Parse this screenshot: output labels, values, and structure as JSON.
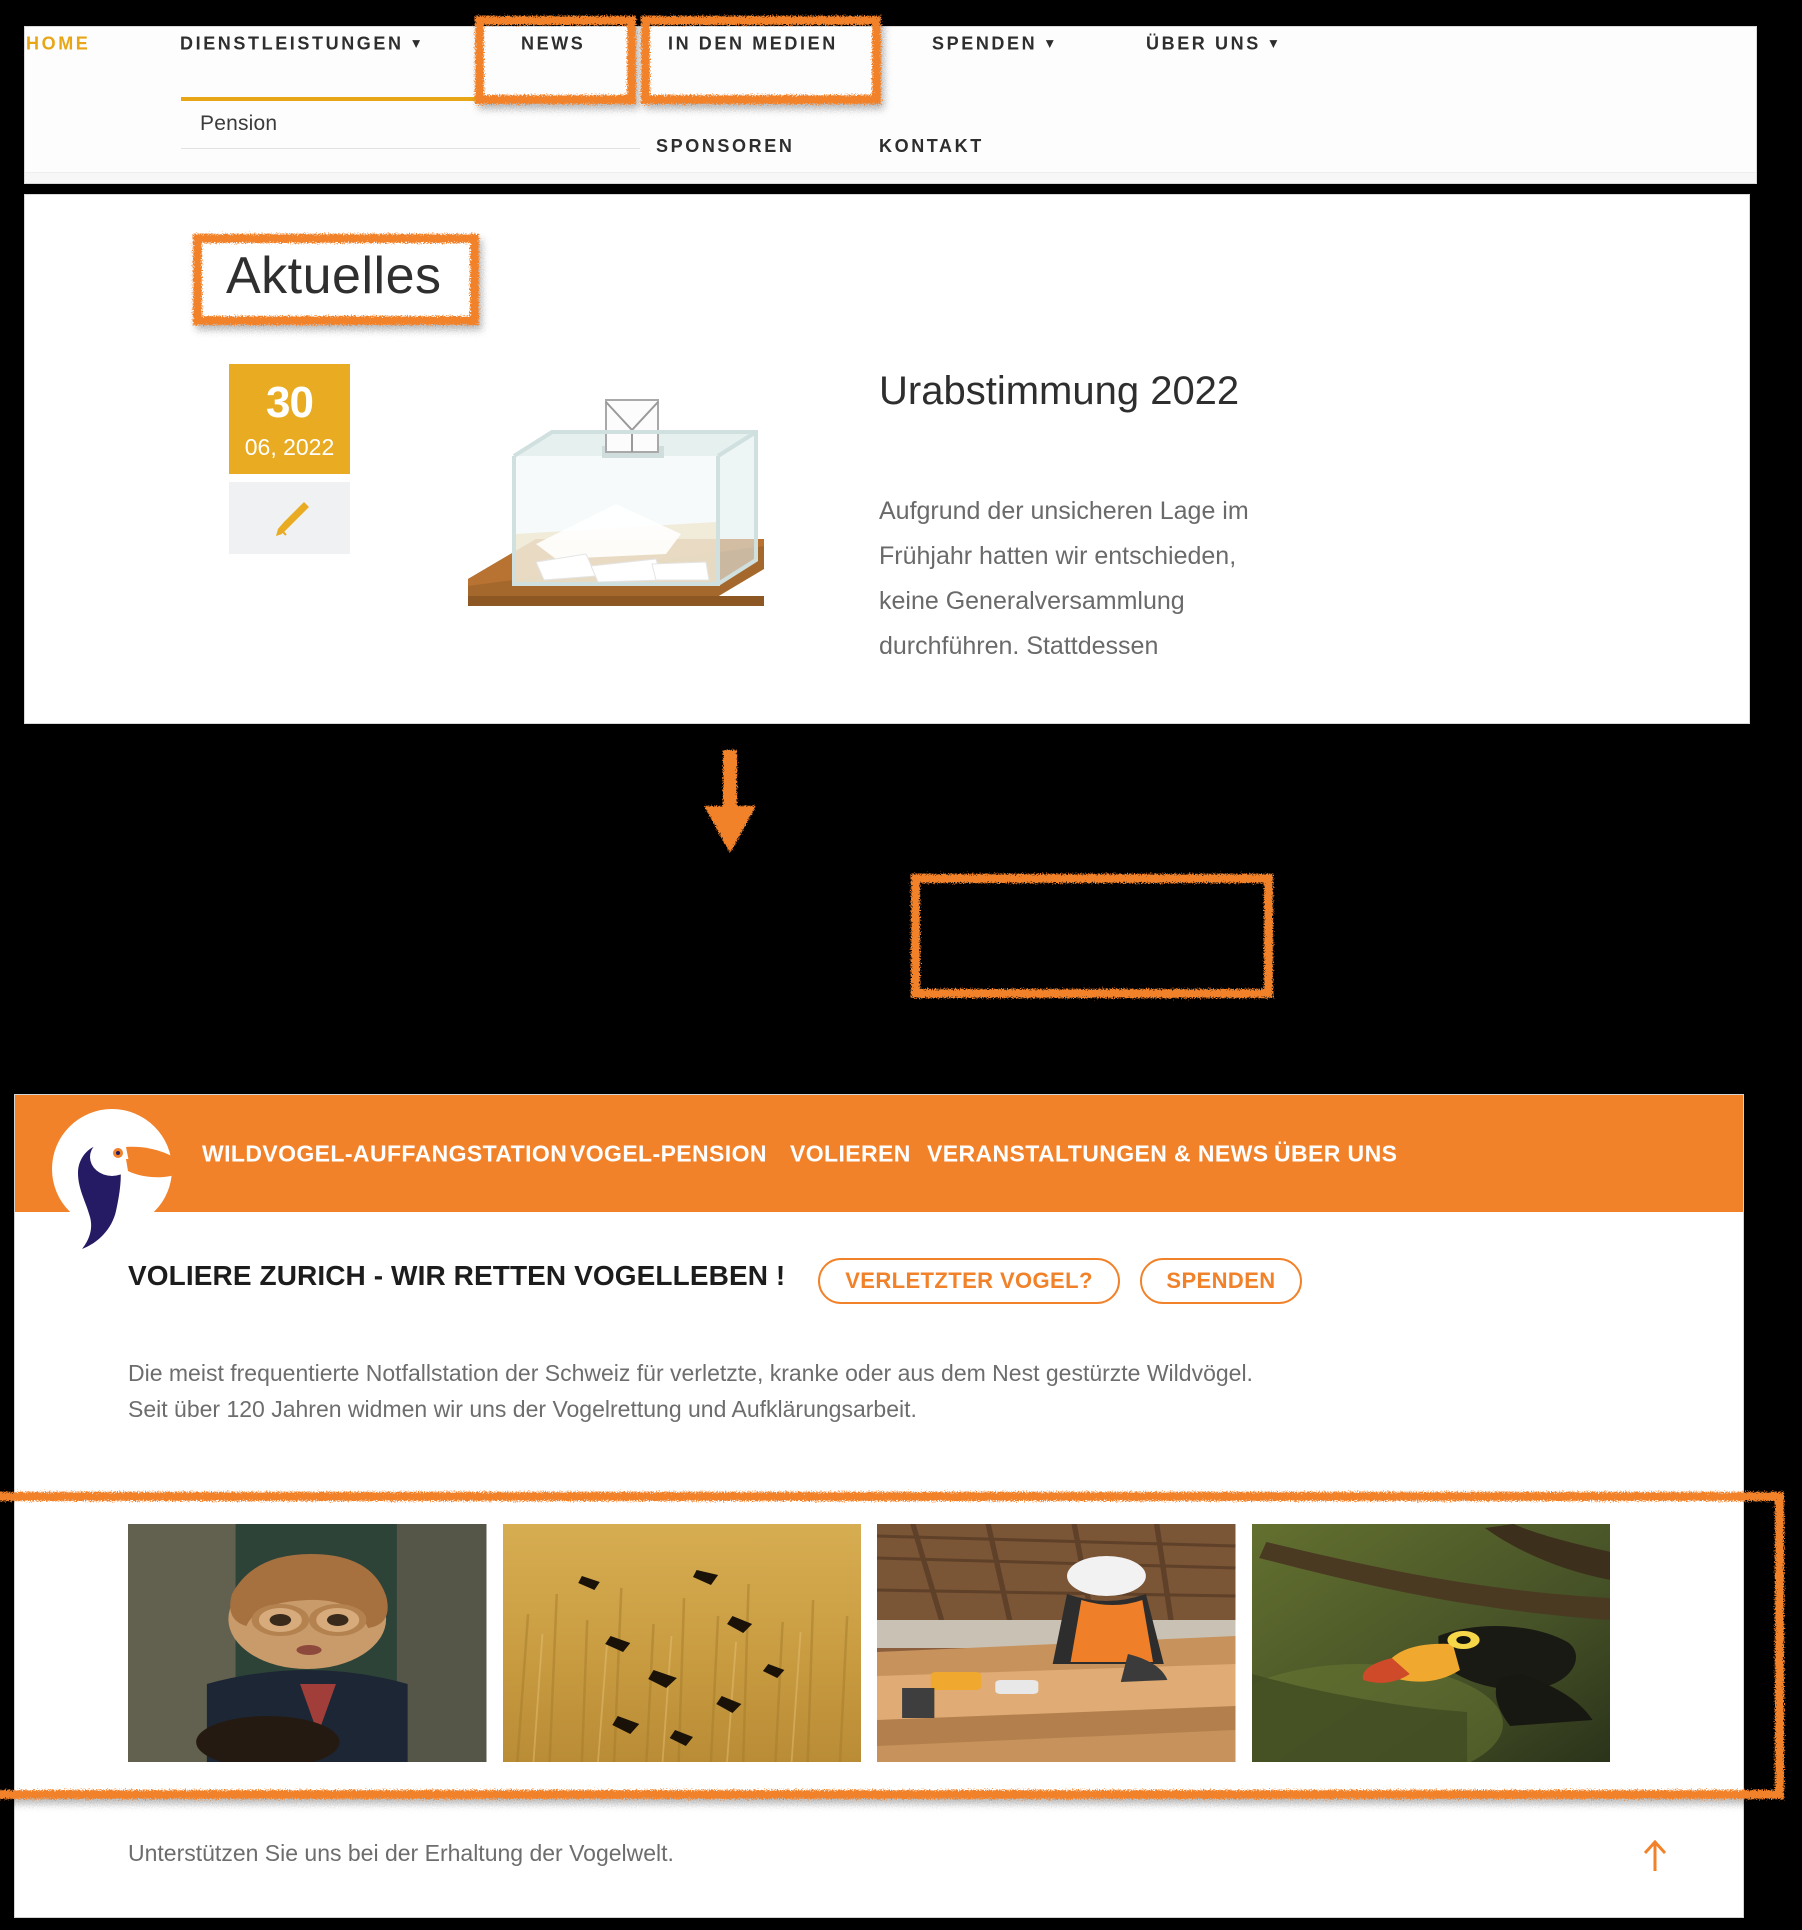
{
  "top_screenshot": {
    "nav": {
      "items": [
        {
          "label": "HOME",
          "active": true,
          "caret": false
        },
        {
          "label": "DIENSTLEISTUNGEN",
          "active": false,
          "caret": true
        },
        {
          "label": "NEWS",
          "active": false,
          "caret": false
        },
        {
          "label": "IN DEN MEDIEN",
          "active": false,
          "caret": false
        },
        {
          "label": "SPENDEN",
          "active": false,
          "caret": true
        },
        {
          "label": "ÜBER UNS",
          "active": false,
          "caret": true
        }
      ],
      "submenu_open_item": "DIENSTLEISTUNGEN",
      "submenu_items": [
        "Pension"
      ],
      "second_row": [
        "SPONSOREN",
        "KONTAKT"
      ],
      "caret_glyph": "chevron-down"
    },
    "content": {
      "section_title": "Aktuelles",
      "post": {
        "date_day": "30",
        "date_month_year": "06, 2022",
        "icon": "pen-nib-icon",
        "image": "ballot-box-illustration",
        "title": "Urabstimmung 2022",
        "body": "Aufgrund der unsicheren Lage im Frühjahr hatten wir entschieden, keine Generalversammlung durchführen. Stattdessen"
      }
    }
  },
  "flow": {
    "arrow": "down-arrow-icon"
  },
  "bottom_screenshot": {
    "logo": "toucan-logo",
    "nav_items": [
      "WILDVOGEL-AUFFANGSTATION",
      "VOGEL-PENSION",
      "VOLIEREN",
      "VERANSTALTUNGEN & NEWS",
      "ÜBER UNS"
    ],
    "claim": "VOLIERE ZURICH - WIR RETTEN VOGELLEBEN !",
    "buttons": [
      {
        "label": "VERLETZTER VOGEL?",
        "name": "injured-bird-button"
      },
      {
        "label": "SPENDEN",
        "name": "donate-button"
      }
    ],
    "lede_line1": "Die meist frequentierte Notfallstation der Schweiz für verletzte, kranke oder aus dem Nest gestürzte Wildvögel.",
    "lede_line2": "Seit über 120 Jahren widmen wir uns der Vogelrettung und Aufklärungsarbeit.",
    "gallery": [
      {
        "name": "gallery-image-child-binoculars",
        "alt": "child making binoculars with hands"
      },
      {
        "name": "gallery-image-birds-field",
        "alt": "birds flying over golden field"
      },
      {
        "name": "gallery-image-workshop",
        "alt": "worker building wooden aviary"
      },
      {
        "name": "gallery-image-toucan-branch",
        "alt": "toucan bird perched on branch"
      }
    ],
    "footer_text": "Unterstützen Sie uns bei der Erhaltung der Vogelwelt.",
    "to_top": "scroll-to-top-arrow-icon"
  },
  "annotations": {
    "highlight_color": "#f2822a",
    "highlights": [
      {
        "name": "highlight-news",
        "target": "NEWS"
      },
      {
        "name": "highlight-in-den-medien",
        "target": "IN DEN MEDIEN"
      },
      {
        "name": "highlight-aktuelles",
        "target": "Aktuelles"
      },
      {
        "name": "highlight-veranstaltungen-news",
        "target": "VERANSTALTUNGEN & NEWS"
      },
      {
        "name": "highlight-gallery",
        "target": "image gallery strip"
      }
    ]
  },
  "colors": {
    "brand_orange": "#f2822a",
    "accent_gold": "#e8a617",
    "date_badge": "#e8ab22",
    "logo_navy": "#241b64",
    "text_dark": "#2e2e2e",
    "text_muted": "#6d6d6d",
    "background": "#000000"
  }
}
